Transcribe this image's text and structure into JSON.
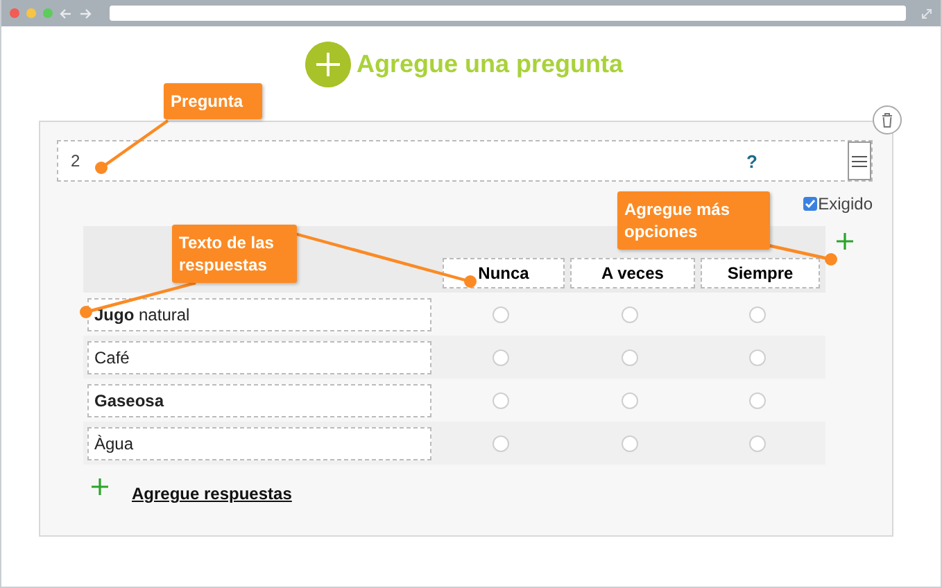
{
  "add_question": {
    "label": "Agregue una pregunta"
  },
  "question": {
    "number": "2",
    "help": "?",
    "required": {
      "label": "Exigido",
      "checked": true
    }
  },
  "columns": [
    {
      "label": "Nunca"
    },
    {
      "label": "A veces"
    },
    {
      "label": "Siempre"
    }
  ],
  "rows": [
    {
      "text": "**Jugo** natural",
      "bold": false,
      "choices": [
        {
          "selected": false
        },
        {
          "selected": false
        },
        {
          "selected": false
        }
      ]
    },
    {
      "text": "Café",
      "bold": false,
      "choices": [
        {
          "selected": false
        },
        {
          "selected": false
        },
        {
          "selected": false
        }
      ]
    },
    {
      "text": "Gaseosa",
      "bold": true,
      "choices": [
        {
          "selected": false
        },
        {
          "selected": false
        },
        {
          "selected": false
        }
      ]
    },
    {
      "text": "Àgua",
      "bold": false,
      "choices": [
        {
          "selected": false
        },
        {
          "selected": false
        },
        {
          "selected": false
        }
      ]
    }
  ],
  "add_answers": {
    "label": "Agregue respuestas"
  },
  "callouts": [
    {
      "kind": "question",
      "text": "Pregunta"
    },
    {
      "kind": "answers",
      "text": "Texto de las respuestas"
    },
    {
      "kind": "options",
      "text": "Agregue más opciones"
    }
  ]
}
